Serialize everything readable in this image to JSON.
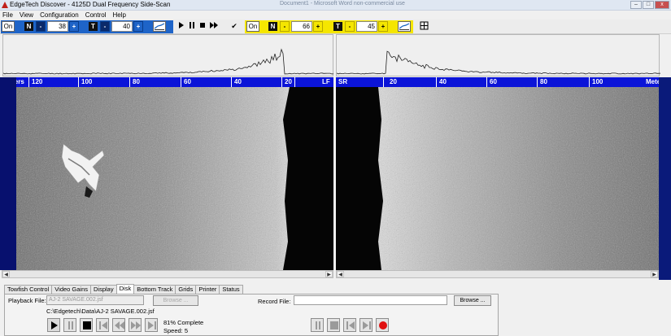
{
  "window": {
    "title": "EdgeTech  Discover - 4125D  Dual Frequency Side-Scan",
    "background_title": "Document1 - Microsoft Word non-commercial use",
    "controls": [
      "–",
      "□",
      "x"
    ]
  },
  "menu": [
    "File",
    "View",
    "Configuration",
    "Control",
    "Help"
  ],
  "toolbar": {
    "left": {
      "on": "On",
      "n_label": "N",
      "n_value": "38",
      "t_label": "T",
      "t_value": "40"
    },
    "right": {
      "on": "On",
      "n_label": "N",
      "n_value": "66",
      "t_label": "T",
      "t_value": "45"
    },
    "minus": "-",
    "plus": "+",
    "checkmark": "✔"
  },
  "left_channel": {
    "scale_unit": "Meters",
    "scale_end": "LF",
    "ticks": [
      "120",
      "100",
      "80",
      "60",
      "40",
      "20"
    ]
  },
  "right_channel": {
    "scale_start": "SR",
    "scale_unit": "Meters",
    "ticks": [
      "20",
      "40",
      "60",
      "80",
      "100"
    ]
  },
  "tabs": [
    {
      "label": "Towfish Control",
      "active": false
    },
    {
      "label": "Video Gains",
      "active": false
    },
    {
      "label": "Display",
      "active": false
    },
    {
      "label": "Disk",
      "active": true
    },
    {
      "label": "Bottom Track",
      "active": false
    },
    {
      "label": "Grids",
      "active": false
    },
    {
      "label": "Printer",
      "active": false
    },
    {
      "label": "Status",
      "active": false
    }
  ],
  "disk": {
    "playback_label": "Playback File:",
    "playback_value": "AJ-2 SAVAGE.002.jsf",
    "browse_label": "Browse ...",
    "path": "C:\\Edgetech\\Data\\AJ-2 SAVAGE.002.jsf",
    "progress": "81% Complete",
    "progress_fraction": 0.81,
    "speed": "Speed: 5",
    "record_label": "Record File:",
    "record_value": "",
    "record_browse_label": "Browse ..."
  },
  "colors": {
    "scale_bar": "#0b14d8",
    "frame": "#07106e",
    "record_dot": "#e01010",
    "toolbar_left_band": "#1e64c8",
    "toolbar_right_band": "#f5e600"
  }
}
